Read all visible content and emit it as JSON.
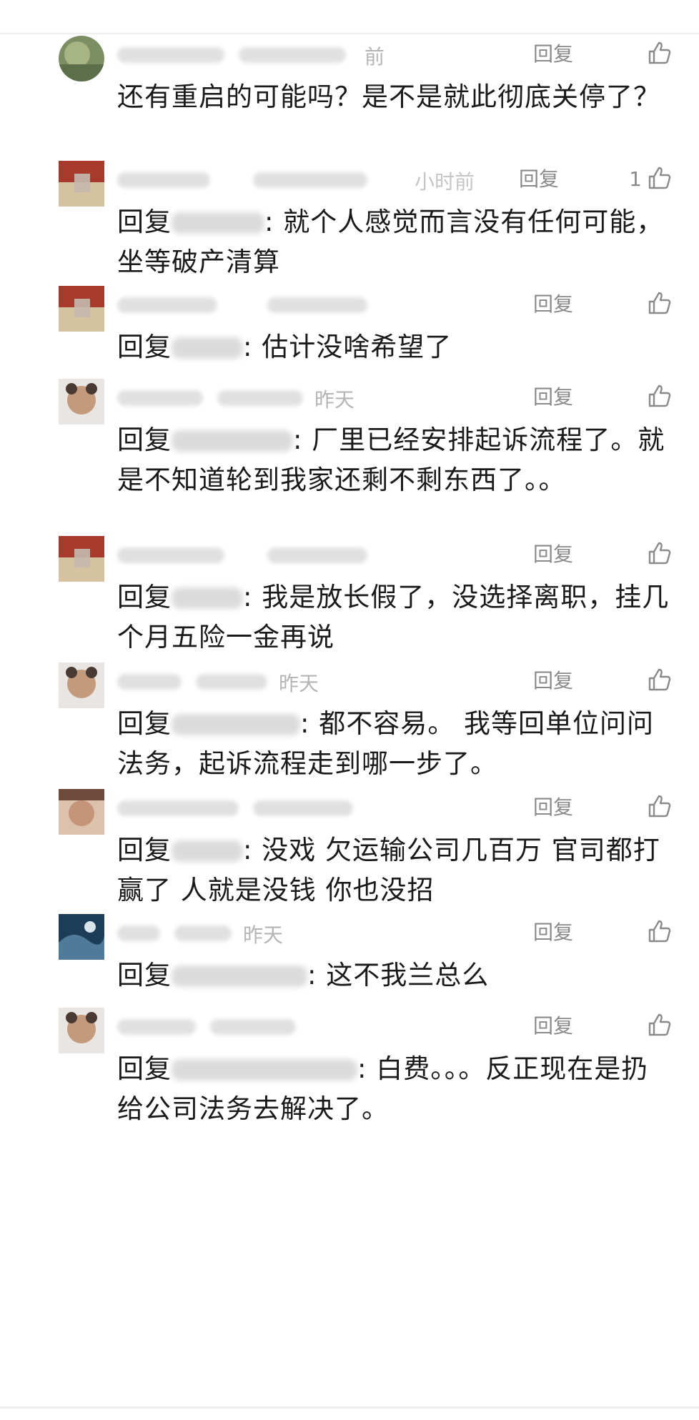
{
  "reply_label": "回复",
  "comments": [
    {
      "text": "还有重启的可能吗？是不是就此彻底关停了？",
      "reply_to": "",
      "like_count": "",
      "time": "前"
    },
    {
      "reply_to": "回复",
      "target": "",
      "text": ": 就个人感觉而言没有任何可能，坐等破产清算",
      "like_count": "1",
      "time": "小时前"
    },
    {
      "reply_to": "回复",
      "target": "",
      "text": ": 估计没啥希望了",
      "like_count": "",
      "time": ""
    },
    {
      "reply_to": "回复",
      "target": "",
      "text": ": 厂里已经安排起诉流程了。就是不知道轮到我家还剩不剩东西了。。",
      "like_count": "",
      "time": "昨天"
    },
    {
      "reply_to": "回复",
      "target": "",
      "text": ": 我是放长假了，没选择离职，挂几个月五险一金再说",
      "like_count": "",
      "time": ""
    },
    {
      "reply_to": "回复",
      "target": "",
      "text": ": 都不容易。 我等回单位问问法务，起诉流程走到哪一步了。",
      "like_count": "",
      "time": "昨天"
    },
    {
      "reply_to": "回复",
      "target": "",
      "text": ": 没戏 欠运输公司几百万 官司都打赢了 人就是没钱 你也没招",
      "like_count": "",
      "time": ""
    },
    {
      "reply_to": "回复",
      "target": "",
      "text": ": 这不我兰总么",
      "like_count": "",
      "time": "昨天"
    },
    {
      "reply_to": "回复",
      "target": "",
      "text": ": 白费。。。反正现在是扔给公司法务去解决了。",
      "like_count": "",
      "time": ""
    }
  ]
}
